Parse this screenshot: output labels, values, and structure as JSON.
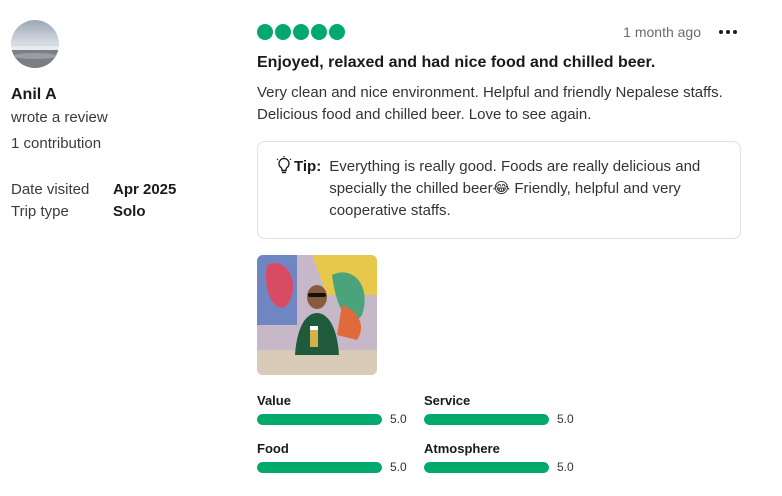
{
  "reviewer": {
    "name": "Anil A",
    "action": "wrote a review",
    "contributions": "1 contribution",
    "details": [
      {
        "label": "Date visited",
        "value": "Apr 2025"
      },
      {
        "label": "Trip type",
        "value": "Solo"
      }
    ]
  },
  "review": {
    "bubble_rating": 5,
    "date": "1 month ago",
    "title": "Enjoyed, relaxed and had nice food and chilled beer.",
    "body": "Very clean and nice environment. Helpful and friendly Nepalese staffs. Delicious food and chilled beer. Love to see again.",
    "tip_label": "Tip:",
    "tip_text": "Everything is really good. Foods are really delicious and specially the chilled beer😂 Friendly, helpful and very cooperative staffs."
  },
  "subratings": [
    {
      "label": "Value",
      "value": "5.0",
      "fraction": 1.0
    },
    {
      "label": "Service",
      "value": "5.0",
      "fraction": 1.0
    },
    {
      "label": "Food",
      "value": "5.0",
      "fraction": 1.0
    },
    {
      "label": "Atmosphere",
      "value": "5.0",
      "fraction": 1.0
    }
  ],
  "colors": {
    "accent": "#00aa6c"
  },
  "icons": {
    "more": "more-dots-icon",
    "tip": "lightbulb-icon"
  }
}
